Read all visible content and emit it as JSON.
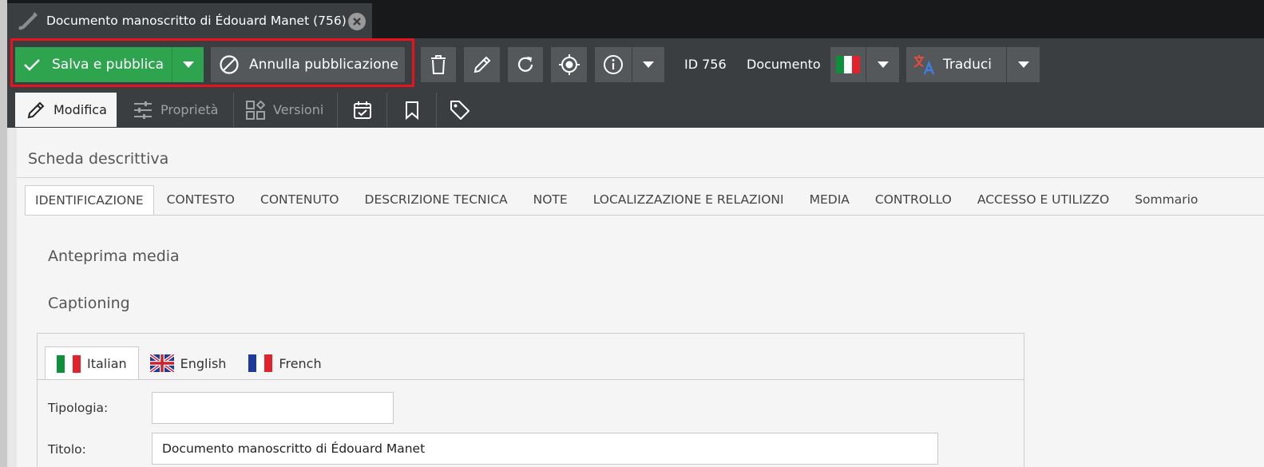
{
  "window": {
    "tab_title": "Documento manoscritto di Édouard Manet (756)",
    "tab_icon": "pen-icon",
    "close_icon": "close-icon"
  },
  "toolbar": {
    "publish_label": "Salva e pubblica",
    "unpublish_label": "Annulla pubblicazione",
    "id_text": "ID 756",
    "type_text": "Documento",
    "translate_label": "Traduci",
    "colors": {
      "publish": "#2ea44f",
      "highlight": "#e8131d",
      "toolbar_bg": "#3b3e41",
      "button_bg": "#55585b"
    },
    "icons": [
      "check-icon",
      "chevron-down-icon",
      "ban-icon",
      "trash-icon",
      "pencil-icon",
      "reload-icon",
      "crosshair-icon",
      "info-icon",
      "italy-flag-icon",
      "translate-icon"
    ]
  },
  "subtabs": [
    {
      "label": "Modifica",
      "icon": "pencil-icon"
    },
    {
      "label": "Proprietà",
      "icon": "sliders-icon"
    },
    {
      "label": "Versioni",
      "icon": "versions-icon"
    },
    {
      "label": "",
      "icon": "calendar-check-icon"
    },
    {
      "label": "",
      "icon": "bookmark-icon"
    },
    {
      "label": "",
      "icon": "tag-icon"
    }
  ],
  "content": {
    "section_title": "Scheda descrittiva",
    "form_tabs": [
      "IDENTIFICAZIONE",
      "CONTESTO",
      "CONTENUTO",
      "DESCRIZIONE TECNICA",
      "NOTE",
      "LOCALIZZAZIONE E RELAZIONI",
      "MEDIA",
      "CONTROLLO",
      "ACCESSO E UTILIZZO",
      "Sommario"
    ],
    "media_preview_title": "Anteprima media",
    "captioning_title": "Captioning",
    "languages": [
      {
        "label": "Italian",
        "flag": "italy-flag-icon"
      },
      {
        "label": "English",
        "flag": "uk-flag-icon"
      },
      {
        "label": "French",
        "flag": "france-flag-icon"
      }
    ],
    "fields": {
      "tipologia_label": "Tipologia:",
      "tipologia_value": "",
      "titolo_label": "Titolo:",
      "titolo_value": "Documento manoscritto di Édouard Manet"
    }
  }
}
